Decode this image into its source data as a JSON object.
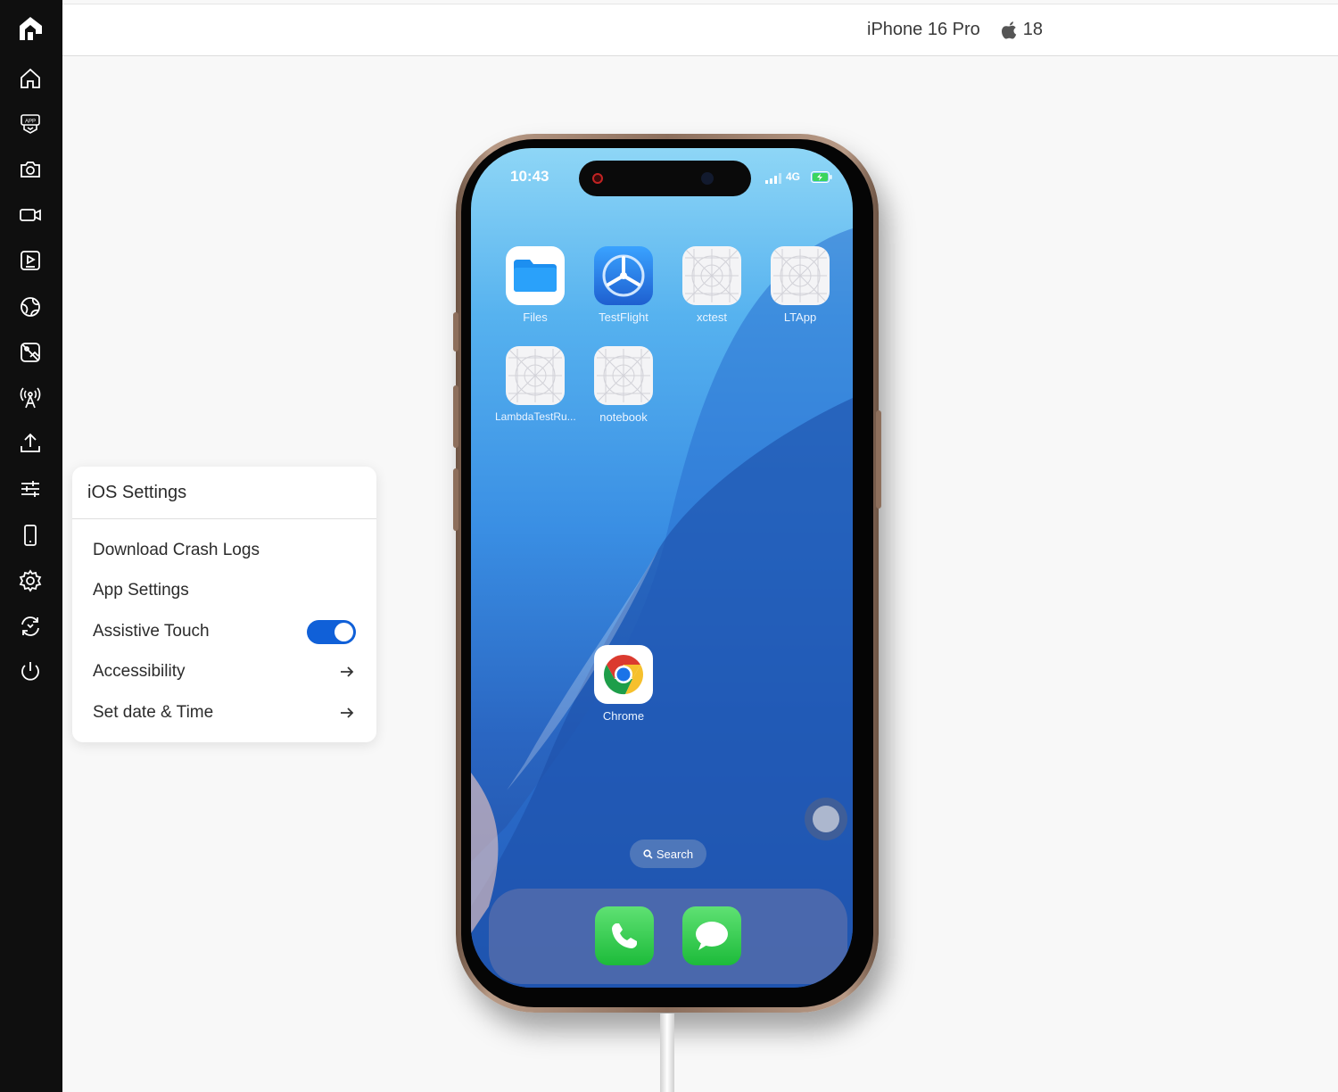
{
  "sidebar": {
    "items": [
      {
        "name": "home-icon"
      },
      {
        "name": "app-icon"
      },
      {
        "name": "camera-icon"
      },
      {
        "name": "video-icon"
      },
      {
        "name": "play-screen-icon"
      },
      {
        "name": "globe-icon"
      },
      {
        "name": "image-off-icon"
      },
      {
        "name": "antenna-icon"
      },
      {
        "name": "upload-icon"
      },
      {
        "name": "sliders-icon"
      },
      {
        "name": "phone-icon"
      },
      {
        "name": "settings-icon"
      },
      {
        "name": "rotate-icon"
      },
      {
        "name": "power-icon"
      }
    ]
  },
  "topbar": {
    "device_name": "iPhone 16 Pro",
    "os_version": "18"
  },
  "settings_panel": {
    "title": "iOS Settings",
    "items": [
      {
        "label": "Download Crash Logs"
      },
      {
        "label": "App Settings"
      },
      {
        "label": "Assistive Touch",
        "toggle": true
      },
      {
        "label": "Accessibility",
        "icon": "arrow-right-icon"
      },
      {
        "label": "Set date & Time",
        "icon": "arrow-right-icon"
      }
    ]
  },
  "phone": {
    "status": {
      "time": "10:43",
      "network": "4G"
    },
    "apps": [
      {
        "label": "Files"
      },
      {
        "label": "TestFlight"
      },
      {
        "label": "xctest"
      },
      {
        "label": "LTApp"
      },
      {
        "label": "LambdaTestRu..."
      },
      {
        "label": "notebook"
      },
      {
        "label": "Chrome"
      }
    ],
    "search_label": "Search",
    "dock": [
      {
        "name": "phone-app-icon"
      },
      {
        "name": "messages-app-icon"
      }
    ]
  }
}
